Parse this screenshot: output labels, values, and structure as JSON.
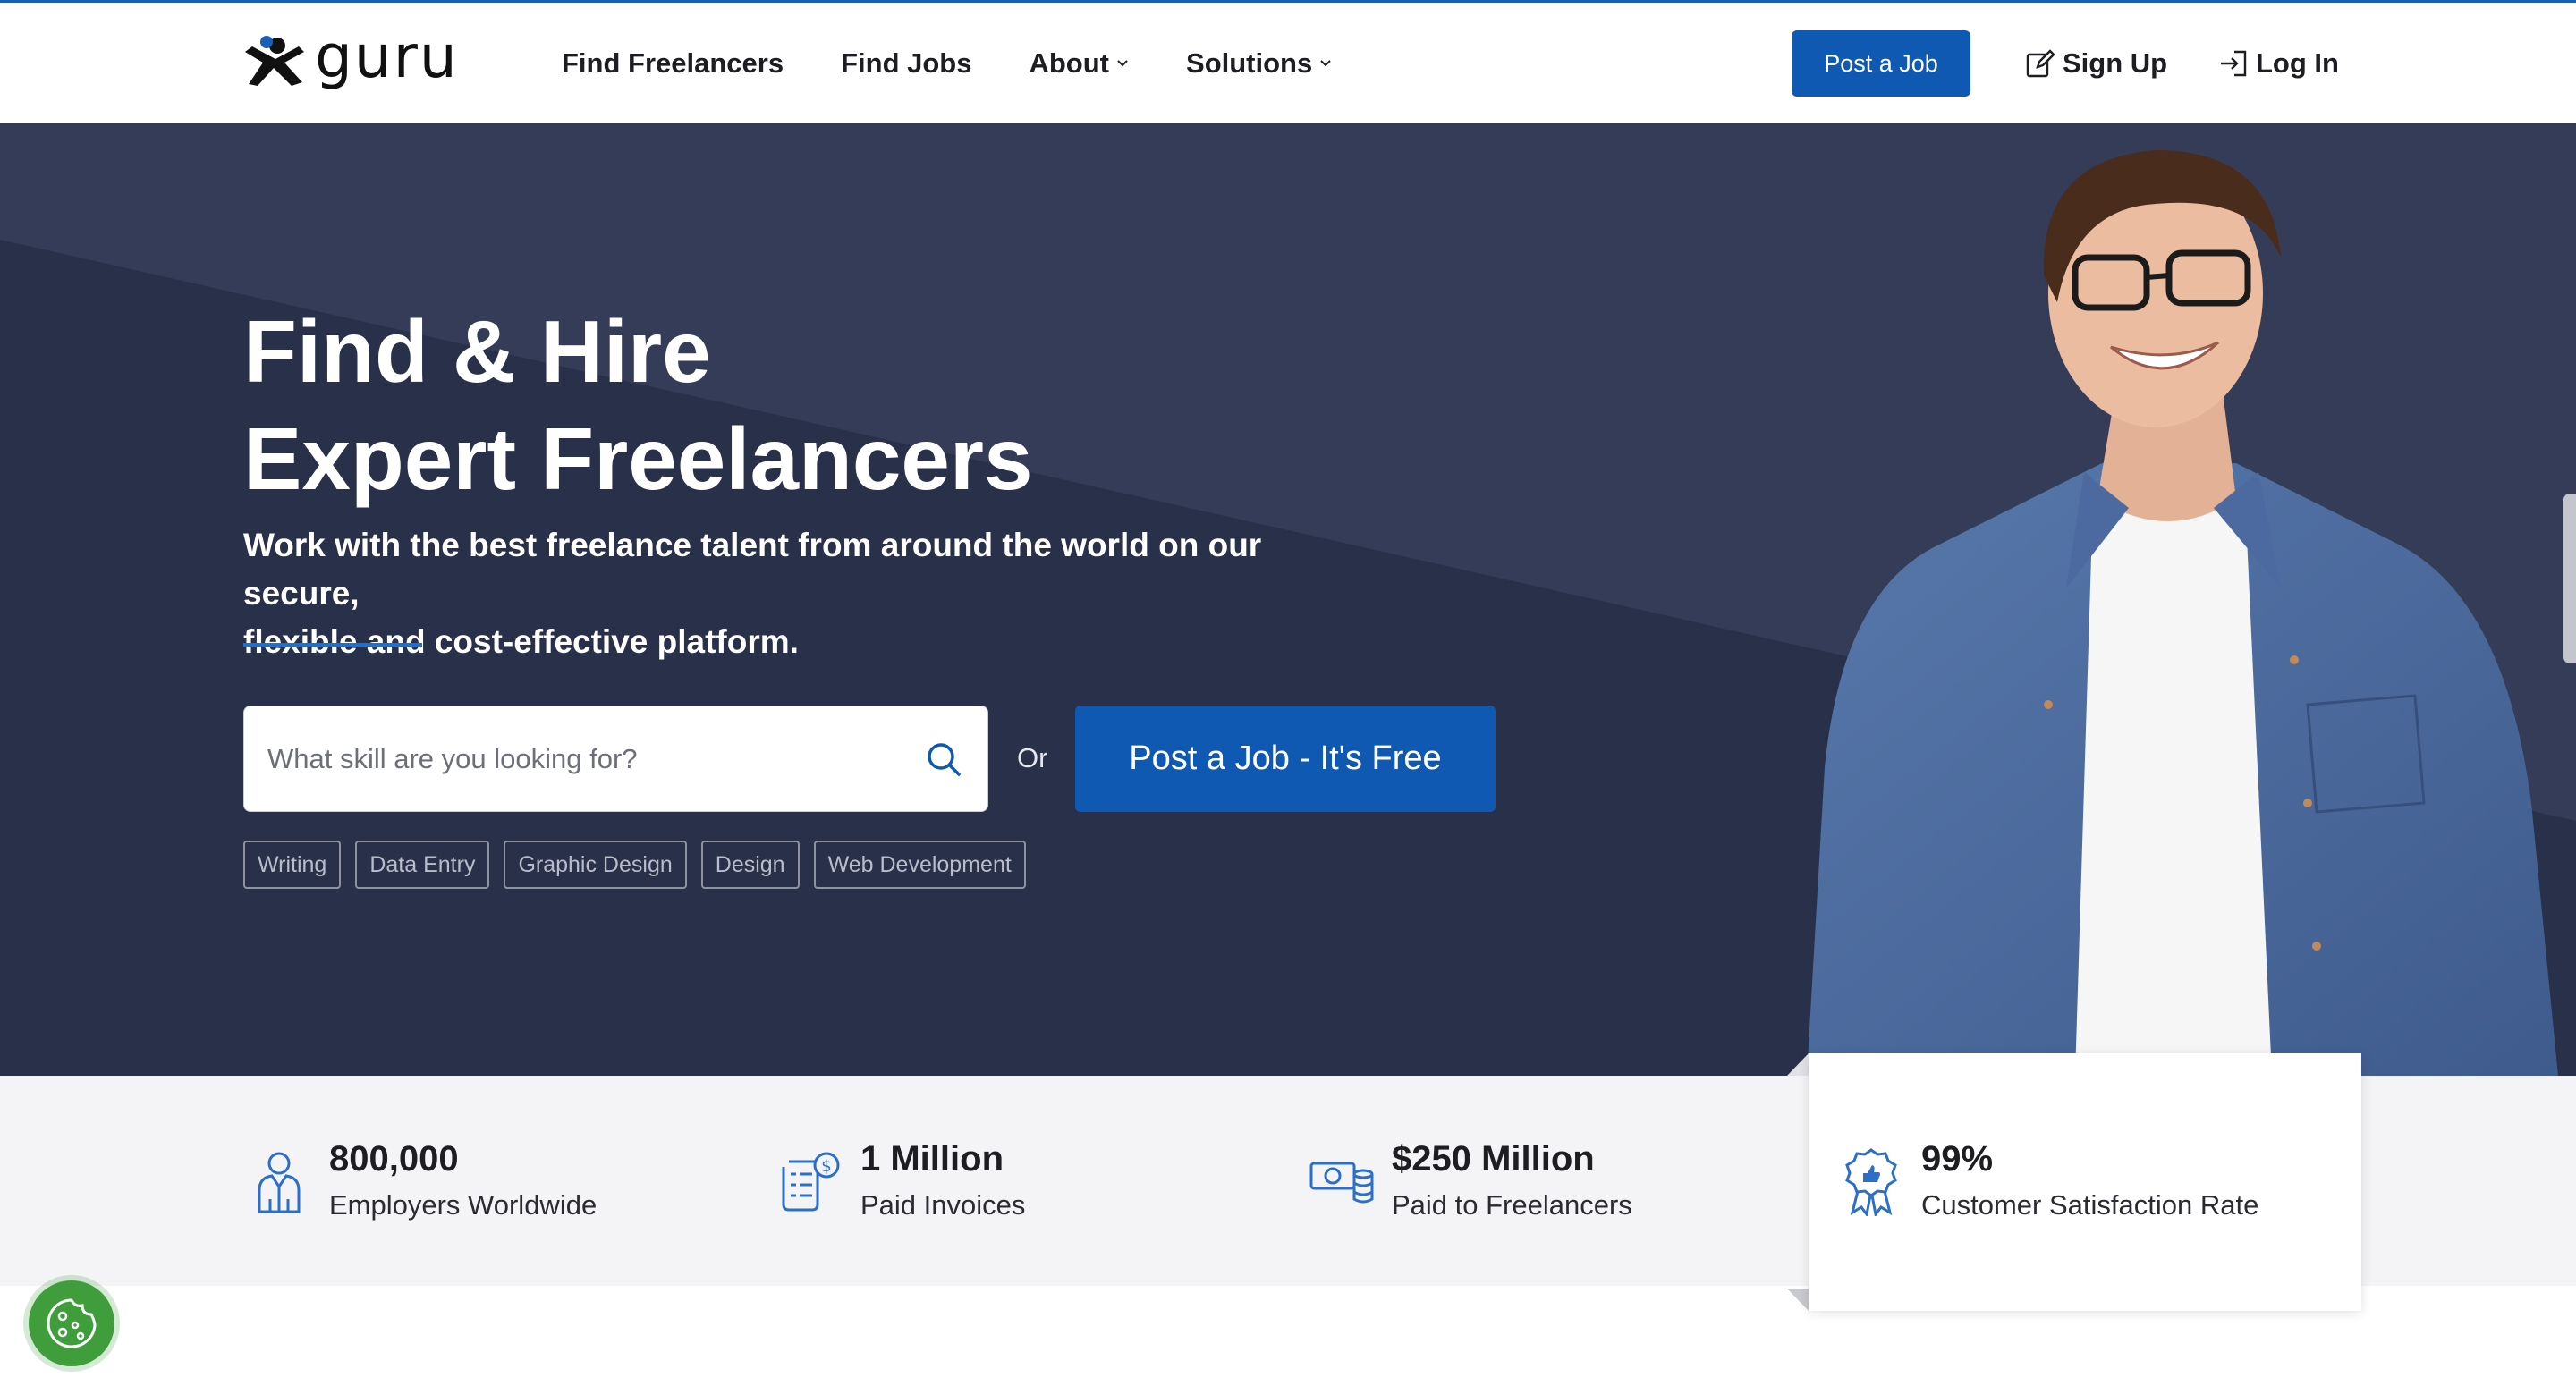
{
  "header": {
    "logo_text": "guru",
    "nav": [
      {
        "label": "Find Freelancers",
        "dropdown": false
      },
      {
        "label": "Find Jobs",
        "dropdown": false
      },
      {
        "label": "About",
        "dropdown": true
      },
      {
        "label": "Solutions",
        "dropdown": true
      }
    ],
    "post_job_label": "Post a Job",
    "signup_label": "Sign Up",
    "login_label": "Log In"
  },
  "hero": {
    "title_line1": "Find & Hire",
    "title_line2": "Expert Freelancers",
    "subtitle_line1": "Work with the best freelance talent from around the world on our secure,",
    "subtitle_line2": "flexible and cost-effective platform.",
    "search_placeholder": "What skill are you looking for?",
    "search_value": "",
    "or_text": "Or",
    "post_job_cta": "Post a Job - It's Free",
    "tags": [
      "Writing",
      "Data Entry",
      "Graphic Design",
      "Design",
      "Web Development"
    ]
  },
  "stats": [
    {
      "value": "800,000",
      "label": "Employers Worldwide",
      "icon": "employer-icon"
    },
    {
      "value": "1 Million",
      "label": "Paid Invoices",
      "icon": "invoice-icon"
    },
    {
      "value": "$250 Million",
      "label": "Paid to Freelancers",
      "icon": "money-icon"
    },
    {
      "value": "99%",
      "label": "Customer Satisfaction Rate",
      "icon": "award-icon"
    }
  ],
  "colors": {
    "brand_blue": "#1059b3",
    "hero_bg": "#2c3450",
    "accent_line": "#1f6fd1",
    "icon_blue": "#2b6fc9",
    "cookie_green": "#3f9e3b"
  }
}
